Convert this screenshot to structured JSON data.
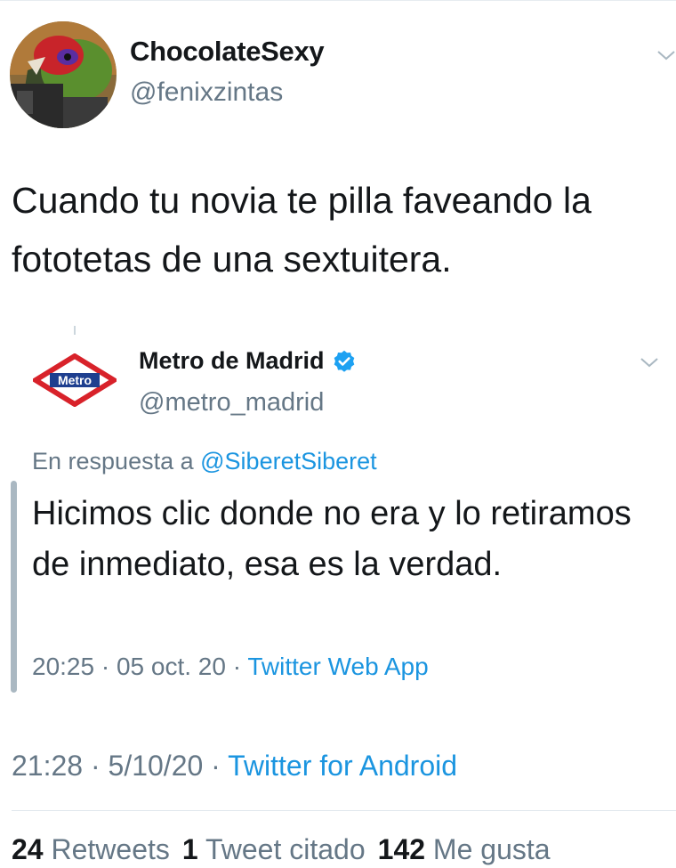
{
  "tweet": {
    "display_name": "ChocolateSexy",
    "handle": "@fenixzintas",
    "text": "Cuando tu novia te pilla faveando la fototetas de una sextuitera.",
    "time": "21:28",
    "date": "5/10/20",
    "source": "Twitter for Android",
    "separator": "·",
    "avatar_icon": "parrot-avatar"
  },
  "quoted": {
    "display_name": "Metro de Madrid",
    "handle": "@metro_madrid",
    "logo_text": "Metro",
    "verified_icon": "verified-badge-icon",
    "reply_prefix": "En respuesta a",
    "reply_mention": "@SiberetSiberet",
    "text": "Hicimos clic donde no era y lo retiramos de inmediato, esa es la verdad.",
    "time": "20:25",
    "date": "05 oct. 20",
    "source": "Twitter Web App",
    "separator": "·"
  },
  "stats": {
    "retweets_count": "24",
    "retweets_label": "Retweets",
    "quotes_count": "1",
    "quotes_label": "Tweet citado",
    "likes_count": "142",
    "likes_label": "Me gusta"
  },
  "colors": {
    "link": "#1b95e0",
    "muted": "#657786",
    "text": "#14171a",
    "metro_red": "#d8222a",
    "metro_blue": "#1e3f8f"
  }
}
